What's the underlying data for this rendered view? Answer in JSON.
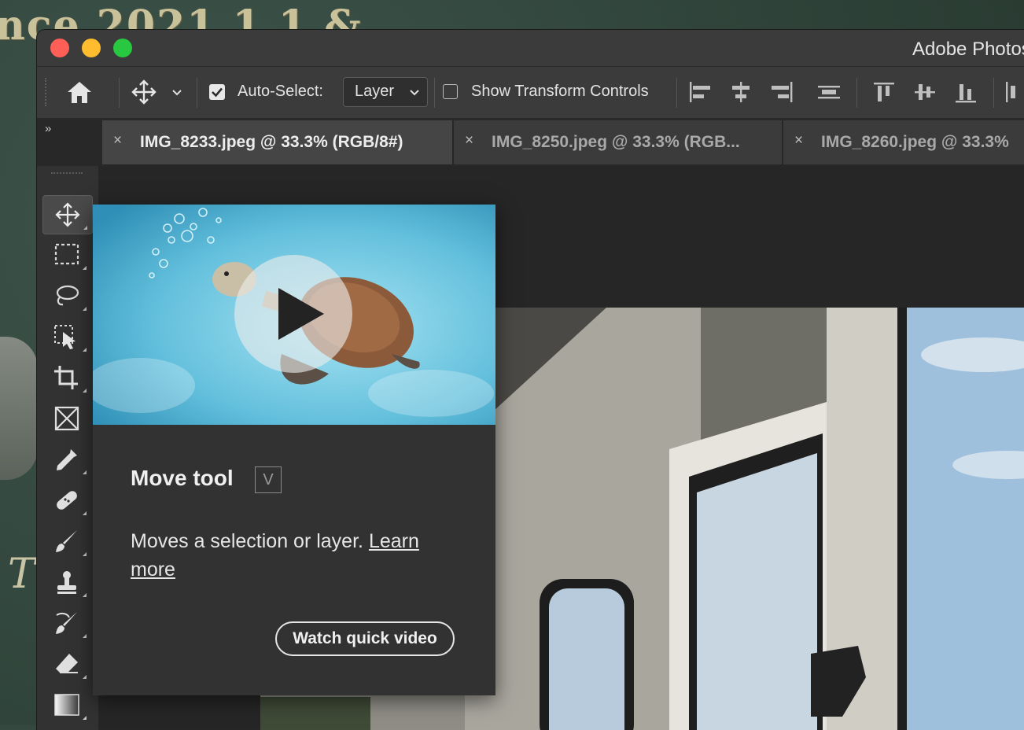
{
  "desktop": {
    "text_top": "nce 2021.1.1 &",
    "text_bottom": "Ti"
  },
  "window": {
    "title": "Adobe Photoshop",
    "traffic_lights": {
      "close": "#ff5f57",
      "minimize": "#febc2e",
      "maximize": "#28c840"
    }
  },
  "options_bar": {
    "home_icon": "home-icon",
    "move_icon": "move-icon",
    "auto_select_label": "Auto-Select:",
    "auto_select_checked": true,
    "auto_select_value": "Layer",
    "show_transform_label": "Show Transform Controls",
    "show_transform_checked": false,
    "align_icons": [
      "align-left-edges-icon",
      "align-horizontal-centers-icon",
      "align-right-edges-icon",
      "distribute-vertical-icon",
      "align-top-edges-icon",
      "align-vertical-centers-icon",
      "align-bottom-edges-icon",
      "distribute-horizontal-icon"
    ]
  },
  "tabs": [
    {
      "close": "×",
      "title": "IMG_8233.jpeg @ 33.3% (RGB/8#)",
      "active": true
    },
    {
      "close": "×",
      "title": "IMG_8250.jpeg @ 33.3% (RGB...",
      "active": false
    },
    {
      "close": "×",
      "title": "IMG_8260.jpeg @ 33.3%",
      "active": false
    }
  ],
  "panel_collapse": "»",
  "toolbar": {
    "tools": [
      "move-tool-icon",
      "rectangular-marquee-icon",
      "lasso-icon",
      "object-selection-icon",
      "crop-icon",
      "frame-icon",
      "eyedropper-icon",
      "healing-brush-icon",
      "brush-icon",
      "clone-stamp-icon",
      "history-brush-icon",
      "eraser-icon",
      "gradient-icon",
      "blur-icon"
    ],
    "selected": "move-tool-icon"
  },
  "tooltip": {
    "title": "Move tool",
    "shortcut": "V",
    "description": "Moves a selection or layer.",
    "learn_more": "Learn more",
    "button": "Watch quick video",
    "video_icon": "play-icon"
  }
}
